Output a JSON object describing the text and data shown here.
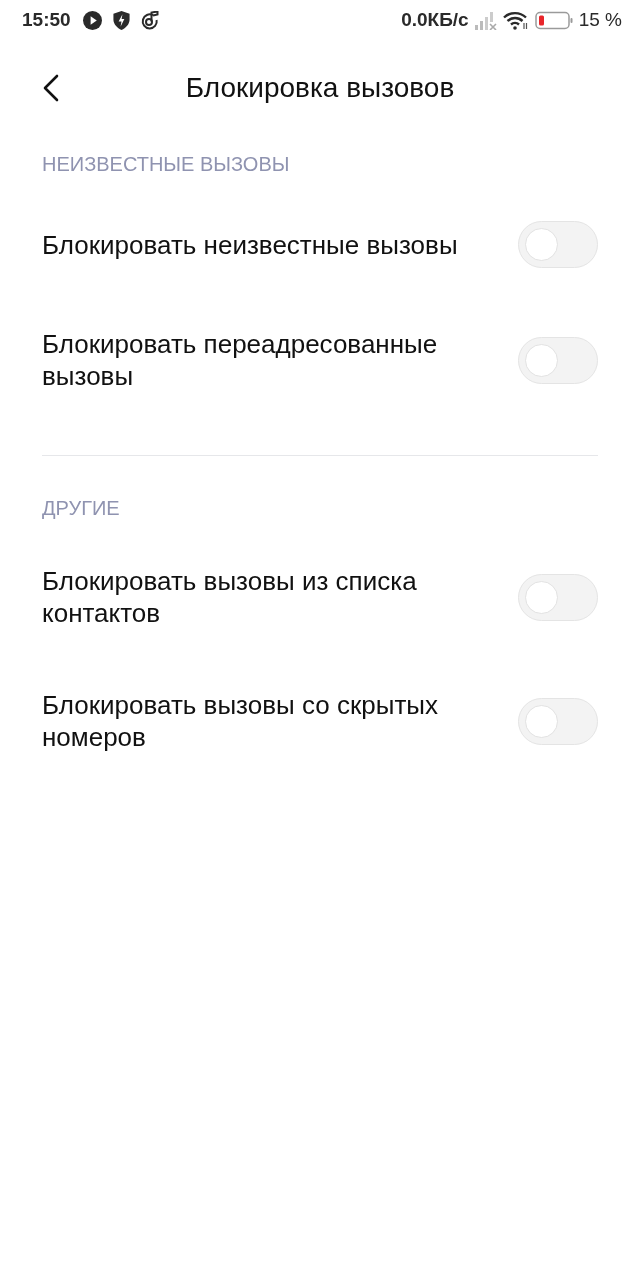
{
  "status_bar": {
    "time": "15:50",
    "network_speed": "0.0КБ/с",
    "battery": "15 %"
  },
  "header": {
    "title": "Блокировка вызовов"
  },
  "sections": [
    {
      "title": "НЕИЗВЕСТНЫЕ ВЫЗОВЫ",
      "items": [
        {
          "label": "Блокировать неизвестные вызовы",
          "on": false
        },
        {
          "label": "Блокировать переадресованные вызовы",
          "on": false
        }
      ]
    },
    {
      "title": "ДРУГИЕ",
      "items": [
        {
          "label": "Блокировать вызовы из списка контактов",
          "on": false
        },
        {
          "label": "Блокировать вызовы со скрытых номеров",
          "on": false
        }
      ]
    }
  ]
}
